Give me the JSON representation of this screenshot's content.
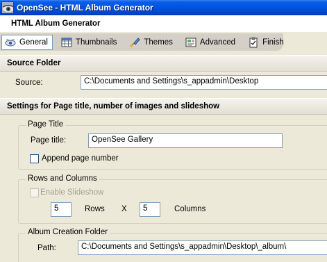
{
  "window": {
    "title": "OpenSee - HTML Album Generator"
  },
  "wizard": {
    "title": "HTML Album Generator"
  },
  "tabs": [
    {
      "label": "General",
      "icon": "general-icon",
      "active": true
    },
    {
      "label": "Thumbnails",
      "icon": "thumbnails-icon",
      "active": false
    },
    {
      "label": "Themes",
      "icon": "themes-icon",
      "active": false
    },
    {
      "label": "Advanced",
      "icon": "advanced-icon",
      "active": false
    },
    {
      "label": "Finish",
      "icon": "finish-icon",
      "active": false
    }
  ],
  "source_section": {
    "header": "Source Folder",
    "source_label": "Source:",
    "source_value": "C:\\Documents and Settings\\s_appadmin\\Desktop"
  },
  "settings_section": {
    "header": "Settings for Page title, number of images and slideshow"
  },
  "page_title_group": {
    "legend": "Page Title",
    "title_label": "Page title:",
    "title_value": "OpenSee Gallery",
    "append_label": "Append page number",
    "append_checked": false
  },
  "rows_columns_group": {
    "legend": "Rows and Columns",
    "slideshow_label": "Enable Slideshow",
    "slideshow_checked": false,
    "slideshow_enabled": false,
    "rows_value": "5",
    "rows_label": "Rows",
    "times_symbol": "X",
    "columns_value": "5",
    "columns_label": "Columns"
  },
  "album_folder_group": {
    "legend": "Album Creation Folder",
    "path_label": "Path:",
    "path_value": "C:\\Documents and Settings\\s_appadmin\\Desktop\\_album\\"
  },
  "colors": {
    "titlebar": "#0054e3",
    "tab_strip": "#d4d0c8",
    "window_bg": "#ece9d8",
    "input_border": "#7f9db9"
  }
}
